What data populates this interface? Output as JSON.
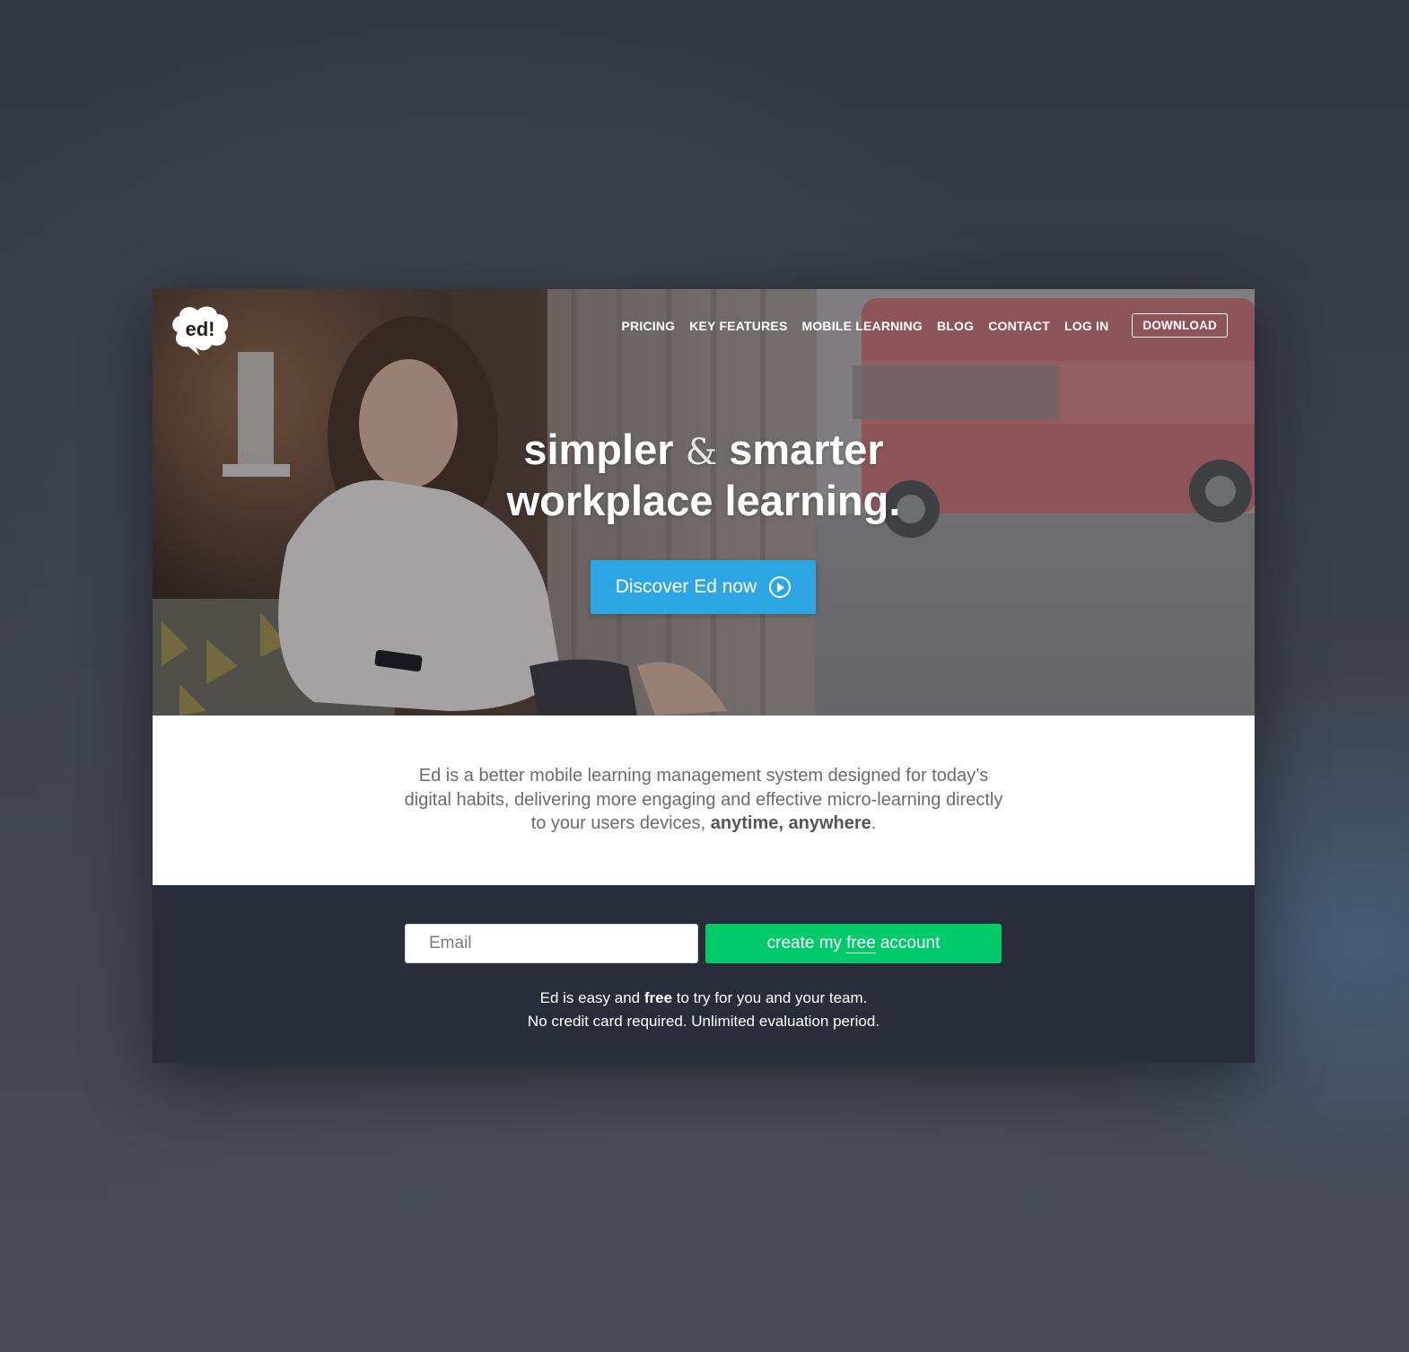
{
  "brand": {
    "logo_text": "ed!"
  },
  "nav": {
    "items": [
      "PRICING",
      "KEY FEATURES",
      "MOBILE LEARNING",
      "BLOG",
      "CONTACT",
      "LOG IN"
    ],
    "download_label": "DOWNLOAD"
  },
  "hero": {
    "headline_line1_a": "simpler",
    "headline_amp": "&",
    "headline_line1_b": "smarter",
    "headline_line2": "workplace learning.",
    "cta_label": "Discover Ed now"
  },
  "intro": {
    "text_main": "Ed is a better mobile learning management system designed for today’s digital habits, delivering more engaging and effective micro-learning directly to your users devices, ",
    "text_bold": "anytime, anywhere",
    "text_end": "."
  },
  "signup": {
    "email_placeholder": "Email",
    "create_pre": "create my",
    "create_free": "free",
    "create_post": "account",
    "note_line1_pre": "Ed is easy and ",
    "note_line1_bold": "free",
    "note_line1_post": " to try for you and your team.",
    "note_line2": "No credit card required. Unlimited evaluation period."
  },
  "colors": {
    "cta_blue": "#2ea6e4",
    "create_green": "#00c96a",
    "signup_bg": "#292d3b"
  }
}
